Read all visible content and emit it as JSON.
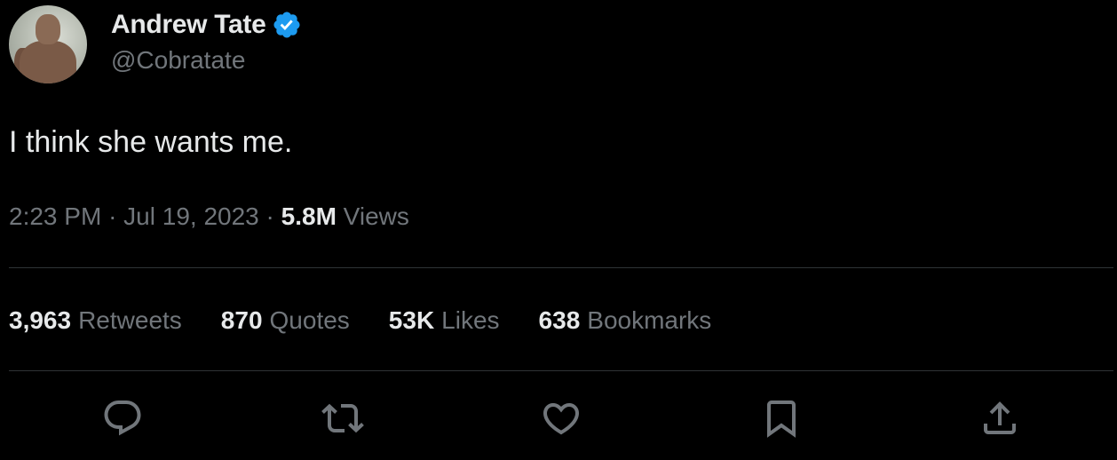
{
  "author": {
    "display_name": "Andrew Tate",
    "handle": "@Cobratate",
    "verified_icon": "verified-badge-icon",
    "verified_color": "#1d9bf0"
  },
  "tweet": {
    "text": "I think she wants me.",
    "time": "2:23 PM",
    "separator": "·",
    "date": "Jul 19, 2023",
    "views_count": "5.8M",
    "views_label": "Views"
  },
  "stats": [
    {
      "count": "3,963",
      "label": "Retweets"
    },
    {
      "count": "870",
      "label": "Quotes"
    },
    {
      "count": "53K",
      "label": "Likes"
    },
    {
      "count": "638",
      "label": "Bookmarks"
    }
  ],
  "actions": [
    {
      "icon": "reply-icon"
    },
    {
      "icon": "retweet-icon"
    },
    {
      "icon": "like-icon"
    },
    {
      "icon": "bookmark-icon"
    },
    {
      "icon": "share-icon"
    }
  ],
  "colors": {
    "background": "#000000",
    "primary_text": "#e7e9ea",
    "secondary_text": "#71767b",
    "divider": "#2f3336"
  }
}
